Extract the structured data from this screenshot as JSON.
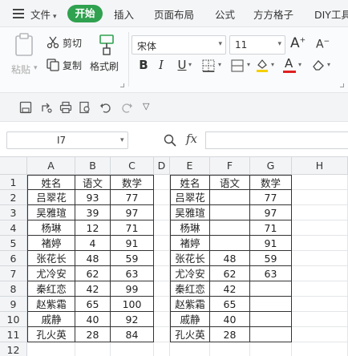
{
  "menubar": {
    "file_label": "文件",
    "tabs": [
      "开始",
      "插入",
      "页面布局",
      "公式",
      "方方格子",
      "DIY工具"
    ]
  },
  "ribbon": {
    "paste_label": "粘贴",
    "cut_label": "剪切",
    "copy_label": "复制",
    "format_painter_label": "格式刷",
    "font_name": "宋体",
    "font_size": "11",
    "bold": "B",
    "italic": "I",
    "underline": "U"
  },
  "formula_bar": {
    "cell_ref": "I7",
    "fx_label": "fx",
    "formula": ""
  },
  "sheet": {
    "columns": [
      "A",
      "B",
      "C",
      "D",
      "E",
      "F",
      "G",
      "H"
    ],
    "rows": [
      "1",
      "2",
      "3",
      "4",
      "5",
      "6",
      "7",
      "8",
      "9",
      "10",
      "11",
      "12"
    ],
    "table1": [
      [
        "姓名",
        "语文",
        "数学"
      ],
      [
        "吕翠花",
        "93",
        "77"
      ],
      [
        "吴雅瑄",
        "39",
        "97"
      ],
      [
        "杨琳",
        "12",
        "71"
      ],
      [
        "褚婷",
        "4",
        "91"
      ],
      [
        "张花长",
        "48",
        "59"
      ],
      [
        "尤冷安",
        "62",
        "63"
      ],
      [
        "秦红恋",
        "42",
        "99"
      ],
      [
        "赵紫霜",
        "65",
        "100"
      ],
      [
        "戚静",
        "40",
        "92"
      ],
      [
        "孔火英",
        "28",
        "84"
      ]
    ],
    "table2": [
      [
        "姓名",
        "语文",
        "数学"
      ],
      [
        "吕翠花",
        "",
        "77"
      ],
      [
        "吴雅瑄",
        "",
        "97"
      ],
      [
        "杨琳",
        "",
        "71"
      ],
      [
        "褚婷",
        "",
        "91"
      ],
      [
        "张花长",
        "48",
        "59"
      ],
      [
        "尤冷安",
        "62",
        "63"
      ],
      [
        "秦红恋",
        "42",
        ""
      ],
      [
        "赵紫霜",
        "65",
        ""
      ],
      [
        "戚静",
        "40",
        ""
      ],
      [
        "孔火英",
        "28",
        ""
      ]
    ]
  },
  "colors": {
    "start_tab": "#2fa14f",
    "grid_line": "#e3e5e8",
    "header_bg": "#f3f4f6"
  }
}
